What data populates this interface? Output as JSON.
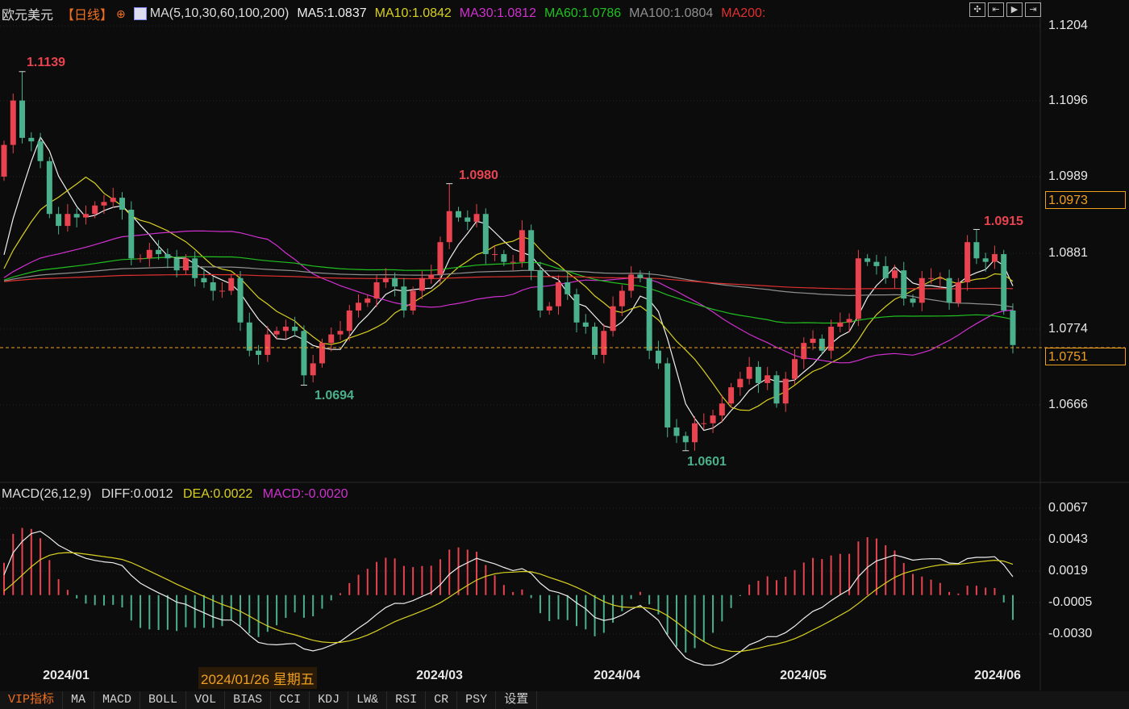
{
  "header": {
    "symbol": "欧元美元",
    "period": "【日线】",
    "period_icon": "globe-icon",
    "ma_title": "MA(5,10,30,60,100,200)",
    "ma5": "MA5:1.0837",
    "ma10": "MA10:1.0842",
    "ma30": "MA30:1.0812",
    "ma60": "MA60:1.0786",
    "ma100": "MA100:1.0804",
    "ma200": "MA200:"
  },
  "tools": [
    "crosshair-icon",
    "zoom-in-icon",
    "play-icon",
    "exit-icon"
  ],
  "price_axis": [
    "1.1204",
    "1.1096",
    "1.0989",
    "1.0881",
    "1.0774",
    "1.0666"
  ],
  "price_boxes": {
    "cursor": "1.0973",
    "last": "1.0751"
  },
  "annotations": {
    "high1": "1.1139",
    "high2": "1.0980",
    "high3": "1.0915",
    "low1": "1.0694",
    "low2": "1.0601"
  },
  "macd_header": {
    "title": "MACD(26,12,9)",
    "diff": "DIFF:0.0012",
    "dea": "DEA:0.0022",
    "macd": "MACD:-0.0020"
  },
  "macd_axis": [
    "0.0067",
    "0.0043",
    "0.0019",
    "-0.0005",
    "-0.0030"
  ],
  "dates": [
    "2024/01",
    "2024/03",
    "2024/04",
    "2024/05",
    "2024/06"
  ],
  "cursor_date": "2024/01/26 星期五",
  "tabs": [
    "VIP指标",
    "MA",
    "MACD",
    "BOLL",
    "VOL",
    "BIAS",
    "CCI",
    "KDJ",
    "LW&",
    "RSI",
    "CR",
    "PSY",
    "设置"
  ],
  "colors": {
    "up": "#e8434f",
    "down": "#4bb08c",
    "ma5": "#f0f0f0",
    "ma10": "#d8d020",
    "ma30": "#d030d0",
    "ma60": "#20c020",
    "ma100": "#909090",
    "ma200": "#e03030",
    "accent": "#f0a020"
  },
  "chart_data": {
    "type": "candlestick",
    "title": "欧元美元 日线",
    "ylim": [
      1.0666,
      1.1204
    ],
    "first_open": 1.099,
    "history_pad": 1.084,
    "close": [
      1.1035,
      1.1098,
      1.1045,
      1.104,
      1.1012,
      1.0937,
      1.092,
      1.0937,
      1.0932,
      1.0937,
      1.0949,
      1.0954,
      1.096,
      1.0943,
      1.0874,
      1.0874,
      1.0886,
      1.088,
      1.0874,
      1.0857,
      1.0874,
      1.0846,
      1.084,
      1.0828,
      1.0828,
      1.0846,
      1.0783,
      1.0743,
      1.0737,
      1.0766,
      1.0771,
      1.0777,
      1.0771,
      1.0708,
      1.0725,
      1.0754,
      1.0766,
      1.0771,
      1.08,
      1.0811,
      1.0817,
      1.084,
      1.0846,
      1.0834,
      1.08,
      1.0828,
      1.0846,
      1.0851,
      1.0897,
      1.0941,
      1.0932,
      1.0926,
      1.0937,
      1.088,
      1.088,
      1.0869,
      1.0869,
      1.0914,
      1.0857,
      1.08,
      1.0806,
      1.084,
      1.0823,
      1.0783,
      1.0777,
      1.0737,
      1.0771,
      1.0806,
      1.0828,
      1.0851,
      1.0846,
      1.0743,
      1.0725,
      1.0634,
      1.0622,
      1.0613,
      1.064,
      1.064,
      1.0651,
      1.0668,
      1.0691,
      1.0703,
      1.072,
      1.0697,
      1.0708,
      1.0668,
      1.0703,
      1.0731,
      1.0754,
      1.076,
      1.0743,
      1.0777,
      1.0783,
      1.0788,
      1.0874,
      1.0869,
      1.0863,
      1.0846,
      1.0857,
      1.0817,
      1.0811,
      1.0846,
      1.0846,
      1.0846,
      1.0811,
      1.084,
      1.0897,
      1.0874,
      1.0869,
      1.088,
      1.08,
      1.0751
    ],
    "extremes": [
      {
        "index": 2,
        "value": 1.1139
      },
      {
        "index": 33,
        "value": 1.0694
      },
      {
        "index": 49,
        "value": 1.098
      },
      {
        "index": 75,
        "value": 1.0601
      },
      {
        "index": 107,
        "value": 1.0915
      }
    ],
    "ma_periods": [
      5,
      10,
      30,
      60,
      100,
      200
    ],
    "macd_params": [
      26,
      12,
      9
    ],
    "macd_ylim": [
      -0.003,
      0.0067
    ]
  }
}
